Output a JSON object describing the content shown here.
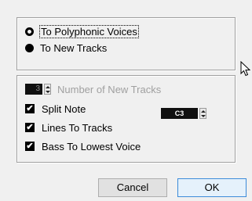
{
  "mode": {
    "option_polyphonic": "To Polyphonic Voices",
    "option_new_tracks": "To New Tracks",
    "selected": "To New Tracks"
  },
  "options": {
    "number_of_tracks_value": "3",
    "number_of_tracks_label": "Number of New Tracks",
    "split_note_label": "Split Note",
    "split_note_value": "C3",
    "split_note_checked": true,
    "lines_to_tracks_label": "Lines To Tracks",
    "lines_to_tracks_checked": true,
    "bass_to_lowest_label": "Bass To Lowest Voice",
    "bass_to_lowest_checked": true
  },
  "buttons": {
    "cancel": "Cancel",
    "ok": "OK"
  },
  "icons": {
    "checkmark": "check-icon",
    "cursor": "mouse-pointer-icon"
  }
}
